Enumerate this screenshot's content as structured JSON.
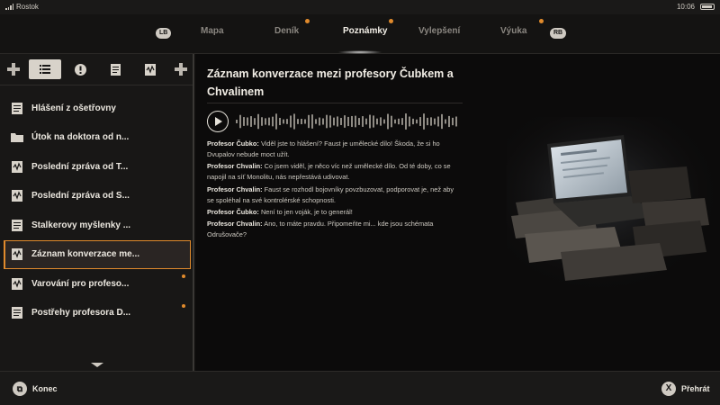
{
  "status": {
    "carrier": "Rostok",
    "time": "10:06"
  },
  "nav": {
    "left_button": "LB",
    "right_button": "RB",
    "tabs": [
      {
        "label": "Mapa",
        "active": false,
        "dot": false
      },
      {
        "label": "Deník",
        "active": false,
        "dot": true
      },
      {
        "label": "Poznámky",
        "active": true,
        "dot": true
      },
      {
        "label": "Vylepšení",
        "active": false,
        "dot": false
      },
      {
        "label": "Výuka",
        "active": false,
        "dot": true
      }
    ]
  },
  "filters": [
    {
      "icon": "list-icon",
      "active": true
    },
    {
      "icon": "alert-icon",
      "active": false
    },
    {
      "icon": "document-icon",
      "active": false
    },
    {
      "icon": "audio-document-icon",
      "active": false
    }
  ],
  "list": [
    {
      "label": "Hlášení z ošetřovny",
      "icon": "document",
      "unread": false,
      "selected": false
    },
    {
      "label": "Útok na doktora od n...",
      "icon": "folder",
      "unread": false,
      "selected": false
    },
    {
      "label": "Poslední zpráva od T...",
      "icon": "audio",
      "unread": false,
      "selected": false
    },
    {
      "label": "Poslední zpráva od S...",
      "icon": "audio",
      "unread": false,
      "selected": false
    },
    {
      "label": "Stalkerovy myšlenky ...",
      "icon": "document",
      "unread": false,
      "selected": false
    },
    {
      "label": "Záznam konverzace me...",
      "icon": "audio",
      "unread": false,
      "selected": true
    },
    {
      "label": "Varování pro profeso...",
      "icon": "audio",
      "unread": true,
      "selected": false
    },
    {
      "label": "Postřehy profesora D...",
      "icon": "document",
      "unread": true,
      "selected": false
    }
  ],
  "note": {
    "title": "Záznam konverzace mezi profesory Čubkem a Chvalinem",
    "lines": [
      {
        "speaker": "Profesor Čubko:",
        "text": "Viděl jste to hlášení? Faust je umělecké dílo! Škoda, že si ho Dvupalov nebude moct užít."
      },
      {
        "speaker": "Profesor Chvalin:",
        "text": "Co jsem viděl, je něco víc než umělecké dílo. Od té doby, co se napojil na síť Monolitu, nás nepřestává udivovat."
      },
      {
        "speaker": "Profesor Chvalin:",
        "text": "Faust se rozhodl bojovníky povzbuzovat, podporovat je, než aby se spoléhal na své kontrolérské schopnosti."
      },
      {
        "speaker": "Profesor Čubko:",
        "text": "Není to jen voják, je to generál!"
      },
      {
        "speaker": "Profesor Chvalin:",
        "text": "Ano, to máte pravdu. Připomeňte mi... kde jsou schémata Odrušovače?"
      }
    ]
  },
  "footer": {
    "back_icon": "back-icon",
    "back_label": "Konec",
    "play_button": "X",
    "play_label": "Přehrát"
  }
}
